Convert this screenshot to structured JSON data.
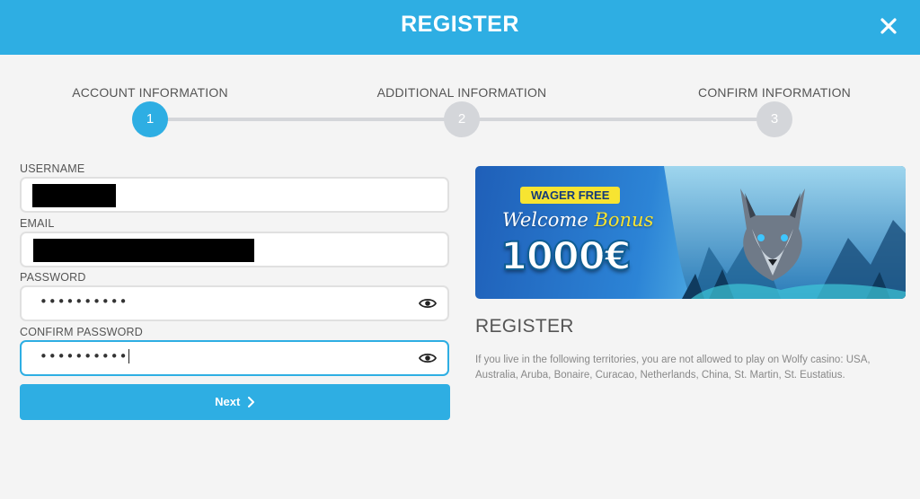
{
  "header": {
    "title": "REGISTER",
    "close_icon": "close-icon"
  },
  "steps": [
    {
      "label": "ACCOUNT INFORMATION",
      "number": "1",
      "active": true
    },
    {
      "label": "ADDITIONAL INFORMATION",
      "number": "2",
      "active": false
    },
    {
      "label": "CONFIRM INFORMATION",
      "number": "3",
      "active": false
    }
  ],
  "form": {
    "username": {
      "label": "USERNAME",
      "value_state": "redacted"
    },
    "email": {
      "label": "EMAIL",
      "value_state": "redacted"
    },
    "password": {
      "label": "PASSWORD",
      "value": "••••••••••",
      "toggle_icon": "eye-icon"
    },
    "confirm_password": {
      "label": "CONFIRM PASSWORD",
      "value": "••••••••••",
      "toggle_icon": "eye-icon"
    },
    "next_label": "Next",
    "next_icon": "chevron-right-icon"
  },
  "banner": {
    "badge": "WAGER FREE",
    "welcome": "Welcome",
    "bonus": "Bonus",
    "amount": "1000€"
  },
  "info": {
    "title": "REGISTER",
    "text": "If you live in the following territories, you are not allowed to play on Wolfy casino: USA, Australia, Aruba, Bonaire, Curacao, Netherlands, China, St. Martin, St. Eustatius."
  },
  "colors": {
    "accent": "#2eaee3",
    "inactive_step": "#d4d6da",
    "background": "#f4f4f4",
    "badge": "#f7e431"
  }
}
